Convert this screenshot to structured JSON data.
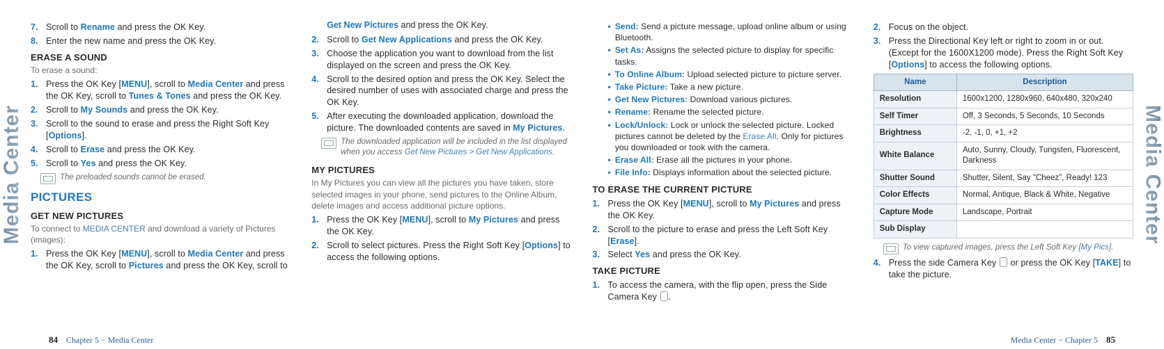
{
  "side_label": "Media Center",
  "footer": {
    "left_page": "84",
    "left_text": "Chapter 5 − Media Center",
    "right_text": "Media Center − Chapter 5",
    "right_page": "85"
  },
  "col1": {
    "l7a": "Scroll to ",
    "l7b": "Rename",
    "l7c": " and press the OK Key.",
    "l8": "Enter the new name and press the OK Key.",
    "erase_h": "ERASE A SOUND",
    "erase_sub": "To erase a sound:",
    "e1a": "Press the OK Key [",
    "menu": "MENU",
    "e1b": "], scroll to ",
    "mc": "Media Center",
    "e1c": " and press the OK Key, scroll to ",
    "tt": "Tunes & Tones",
    "e1d": " and press the OK Key.",
    "e2a": "Scroll to ",
    "ms": "My Sounds",
    "e2b": " and press the OK Key.",
    "e3a": "Scroll to the sound to erase and press the Right Soft Key [",
    "opt": "Options",
    "e3b": "].",
    "e4a": "Scroll to ",
    "er": "Erase",
    "e4b": " and press the OK Key.",
    "e5a": "Scroll to ",
    "yes": "Yes",
    "e5b": " and press the OK Key.",
    "note": "The preloaded sounds cannot be erased.",
    "pic_h": "PICTURES",
    "gnp_h": "GET NEW PICTURES",
    "gnp_sub_a": "To connect to ",
    "gnp_sub_b": "MEDIA CENTER",
    "gnp_sub_c": " and download a variety of Pictures (images):",
    "g1a": "Press the OK Key [",
    "g1b": "], scroll to ",
    "g1c": " and press the OK Key, scroll to ",
    "pics": "Pictures",
    "g1d": " and press the OK Key, scroll to"
  },
  "col2": {
    "cont_a": "Get New Pictures",
    "cont_b": " and press the OK Key.",
    "s2a": "Scroll to ",
    "gna": "Get New Applications",
    "s2b": " and press the OK Key.",
    "s3": "Choose the application you want to download from the list displayed on the screen and press the OK Key.",
    "s4": "Scroll to the desired option and press the OK Key. Select the desired number of uses with associated charge and press the OK Key.",
    "s5a": "After executing the downloaded application, download the picture. The downloaded contents are saved in ",
    "s5b": "My Pictures",
    "s5c": ".",
    "note_a": "The downloaded application will be included in the list displayed when you access ",
    "note_b": "Get New Pictures > Get New Applications.",
    "myp_h": "MY PICTURES",
    "myp_sub": "In My Pictures you can view all the pictures you have taken, store selected images in your phone, send pictures to the Online Album, delete images and access additional picture options.",
    "m1a": "Press the OK Key [",
    "m1b": "], scroll to ",
    "m1c": " and press the OK Key.",
    "m2a": "Scroll to select pictures. Press the Right Soft Key [",
    "m2b": "] to access the following options."
  },
  "col3": {
    "b_send": "Send:",
    "b_send_t": " Send a picture message, upload online album or using Bluetooth.",
    "b_setas": "Set As:",
    "b_setas_t": " Assigns the selected picture to display for specific tasks.",
    "b_online": "To Online Album:",
    "b_online_t": " Upload selected picture to picture server.",
    "b_take": "Take Picture:",
    "b_take_t": " Take a new picture.",
    "b_get": "Get New Pictures:",
    "b_get_t": " Download various pictures.",
    "b_ren": "Rename:",
    "b_ren_t": " Rename the selected picture.",
    "b_lock": "Lock/Unlock:",
    "b_lock_t_a": " Lock or unlock the selected picture. Locked pictures cannot be deleted by the ",
    "b_lock_t_b": "Erase All",
    "b_lock_t_c": ". Only for pictures you downloaded or took with the camera.",
    "b_erase": "Erase All:",
    "b_erase_t": " Erase all the pictures in your phone.",
    "b_file": "File Info:",
    "b_file_t": " Displays information about the selected picture.",
    "tec_h": "TO ERASE THE CURRENT PICTURE",
    "t1a": "Press the OK Key [",
    "t1b": "], scroll to ",
    "t1c": " and press the OK Key.",
    "t2a": "Scroll to the picture to erase and press the Left Soft Key [",
    "t2b": "].",
    "t3a": "Select ",
    "t3b": " and press the OK Key.",
    "tp_h": "TAKE PICTURE",
    "tp1": "To access the camera, with the flip open, press the Side Camera Key ",
    "tp1b": "."
  },
  "col4": {
    "s2": "Focus on the object.",
    "s3a": "Press the Directional Key left or right to zoom in or out. (Except for the 1600X1200 mode). Press the Right Soft Key [",
    "s3b": "] to access the following options.",
    "th_name": "Name",
    "th_desc": "Description",
    "rows": [
      {
        "k": "Resolution",
        "v": "1600x1200, 1280x960, 640x480, 320x240"
      },
      {
        "k": "Self Timer",
        "v": "Off, 3 Seconds,  5 Seconds, 10 Seconds"
      },
      {
        "k": "Brightness",
        "v": "-2, -1, 0, +1, +2"
      },
      {
        "k": "White Balance",
        "v": "Auto, Sunny, Cloudy, Tungsten, Fluorescent, Darkness"
      },
      {
        "k": "Shutter Sound",
        "v": "Shutter, Silent, Say \"Cheez\", Ready! 123"
      },
      {
        "k": "Color Effects",
        "v": "Normal, Antique, Black & White, Negative"
      },
      {
        "k": "Capture Mode",
        "v": "Landscape, Portrait"
      },
      {
        "k": "Sub Display",
        "v": ""
      }
    ],
    "note_a": "To view captured images, press the Left Soft Key [",
    "note_b": "My Pics",
    "note_c": "].",
    "s4a": "Press the side Camera Key ",
    "s4b": " or press the OK Key [",
    "take": "TAKE",
    "s4c": "] to take the picture."
  }
}
